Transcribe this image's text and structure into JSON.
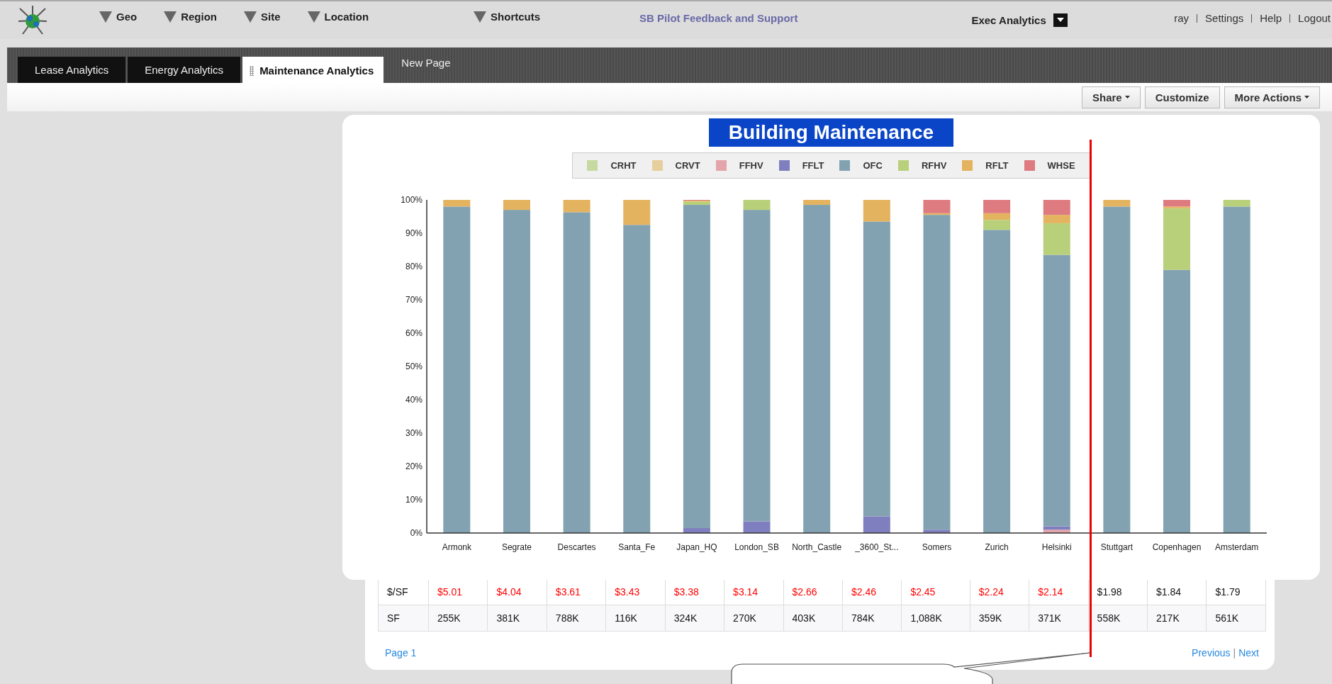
{
  "top_menu": [
    {
      "label": "Geo"
    },
    {
      "label": "Region"
    },
    {
      "label": "Site"
    },
    {
      "label": "Location"
    },
    {
      "label": "Shortcuts"
    }
  ],
  "feedback_link": "SB Pilot Feedback and Support",
  "workspace": "Exec Analytics",
  "user_links": [
    {
      "label": "ray"
    },
    {
      "label": "Settings"
    },
    {
      "label": "Help"
    },
    {
      "label": "Logout"
    }
  ],
  "tabs": [
    {
      "label": "Lease Analytics",
      "selected": false,
      "kind": "tab"
    },
    {
      "label": "Energy Analytics",
      "selected": false,
      "kind": "tab"
    },
    {
      "label": "Maintenance Analytics",
      "selected": true,
      "kind": "tab"
    },
    {
      "label": "New Page",
      "selected": false,
      "kind": "add"
    }
  ],
  "toolbar": [
    {
      "label": "Share",
      "menu": true
    },
    {
      "label": "Customize",
      "menu": false
    },
    {
      "label": "More Actions",
      "menu": true
    }
  ],
  "chart": {
    "title": "Building Maintenance",
    "chart_data": {
      "type": "bar",
      "stacked": true,
      "ylim": [
        0,
        100
      ],
      "yticks": [
        {
          "value": 0,
          "label": "0%"
        },
        {
          "value": 10,
          "label": "10%"
        },
        {
          "value": 20,
          "label": "20%"
        },
        {
          "value": 30,
          "label": "30%"
        },
        {
          "value": 40,
          "label": "40%"
        },
        {
          "value": 50,
          "label": "50%"
        },
        {
          "value": 60,
          "label": "60%"
        },
        {
          "value": 70,
          "label": "70%"
        },
        {
          "value": 80,
          "label": "80%"
        },
        {
          "value": 90,
          "label": "90%"
        },
        {
          "value": 100,
          "label": "100%"
        }
      ],
      "categories": [
        "Armonk",
        "Segrate",
        "Descartes",
        "Santa_Fe",
        "Japan_HQ",
        "London_SB",
        "North_Castle",
        "_3600_St...",
        "Somers",
        "Zurich",
        "Helsinki",
        "Stuttgart",
        "Copenhagen",
        "Amsterdam"
      ],
      "series": [
        {
          "name": "CRHT",
          "color": "#c5d9a0",
          "values": [
            0,
            0,
            0,
            0,
            0,
            0,
            0,
            0,
            0,
            0,
            0,
            0,
            0,
            0
          ]
        },
        {
          "name": "CRVT",
          "color": "#e6cf9c",
          "values": [
            0,
            0,
            0,
            0,
            0,
            0,
            0,
            0,
            0,
            0,
            0,
            0,
            0,
            0
          ]
        },
        {
          "name": "FFHV",
          "color": "#e3a4aa",
          "values": [
            0,
            0,
            0,
            0,
            0,
            0,
            0,
            0,
            0,
            0,
            1,
            0,
            0,
            0
          ]
        },
        {
          "name": "FFLT",
          "color": "#7f7fbf",
          "values": [
            0,
            0,
            0,
            0,
            1.5,
            3.5,
            0,
            5,
            1,
            0,
            1,
            0,
            0,
            0
          ]
        },
        {
          "name": "OFC",
          "color": "#82a2b2",
          "values": [
            98,
            97,
            96.3,
            92.5,
            97,
            93.5,
            98.5,
            88.5,
            94.5,
            91,
            81.5,
            98,
            79,
            98
          ]
        },
        {
          "name": "RFHV",
          "color": "#b9d07a",
          "values": [
            0,
            0,
            0,
            0,
            1,
            3,
            0,
            0,
            0,
            3,
            9.5,
            0,
            18.5,
            2
          ]
        },
        {
          "name": "RFLT",
          "color": "#e4b35f",
          "values": [
            2,
            3,
            3.7,
            7.5,
            0.3,
            0,
            1.5,
            6.5,
            0.5,
            2,
            2.5,
            2,
            0.5,
            0
          ]
        },
        {
          "name": "WHSE",
          "color": "#de7b80",
          "values": [
            0,
            0,
            0,
            0,
            0.2,
            0,
            0,
            0,
            4,
            4,
            4.5,
            0,
            2,
            0
          ]
        }
      ]
    }
  },
  "table": {
    "rows": [
      {
        "label": "$/SF",
        "cells": [
          {
            "text": "$5.01",
            "flagged": true
          },
          {
            "text": "$4.04",
            "flagged": true
          },
          {
            "text": "$3.61",
            "flagged": true
          },
          {
            "text": "$3.43",
            "flagged": true
          },
          {
            "text": "$3.38",
            "flagged": true
          },
          {
            "text": "$3.14",
            "flagged": true
          },
          {
            "text": "$2.66",
            "flagged": true
          },
          {
            "text": "$2.46",
            "flagged": true
          },
          {
            "text": "$2.45",
            "flagged": true
          },
          {
            "text": "$2.24",
            "flagged": true
          },
          {
            "text": "$2.14",
            "flagged": true
          },
          {
            "text": "$1.98",
            "flagged": false
          },
          {
            "text": "$1.84",
            "flagged": false
          },
          {
            "text": "$1.79",
            "flagged": false
          }
        ]
      },
      {
        "label": "SF",
        "cells": [
          {
            "text": "255K",
            "flagged": false
          },
          {
            "text": "381K",
            "flagged": false
          },
          {
            "text": "788K",
            "flagged": false
          },
          {
            "text": "116K",
            "flagged": false
          },
          {
            "text": "324K",
            "flagged": false
          },
          {
            "text": "270K",
            "flagged": false
          },
          {
            "text": "403K",
            "flagged": false
          },
          {
            "text": "784K",
            "flagged": false
          },
          {
            "text": "1,088K",
            "flagged": false
          },
          {
            "text": "359K",
            "flagged": false
          },
          {
            "text": "371K",
            "flagged": false
          },
          {
            "text": "558K",
            "flagged": false
          },
          {
            "text": "217K",
            "flagged": false
          },
          {
            "text": "561K",
            "flagged": false
          }
        ]
      }
    ]
  },
  "pager": {
    "page": "Page 1",
    "previous": "Previous",
    "separator": "|",
    "next": "Next"
  }
}
